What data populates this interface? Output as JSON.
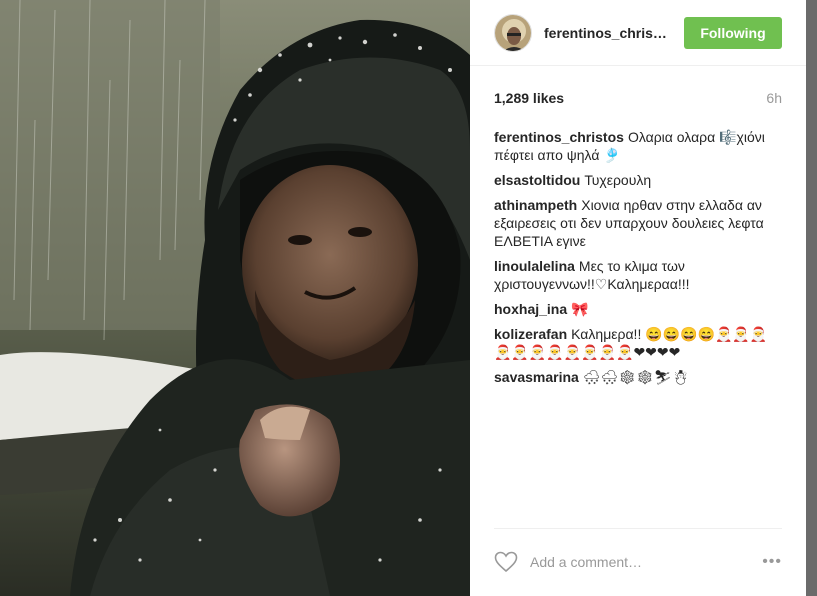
{
  "post": {
    "username": "ferentinos_chris…",
    "follow_label": "Following",
    "likes": "1,289 likes",
    "time": "6h"
  },
  "comments": [
    {
      "user": "ferentinos_christos",
      "text": "Ολαρια ολαρα 🎼χιόνι πέφτει απο ψηλά 🎐"
    },
    {
      "user": "elsastoltidou",
      "text": "Τυχερουλη"
    },
    {
      "user": "athinampeth",
      "text": "Χιονια ηρθαν στην ελλαδα αν εξαιρεσεις οτι δεν υπαρχουν δουλειες λεφτα ΕΛΒΕΤΙΑ εγινε"
    },
    {
      "user": "linoulalelina",
      "text": "Μες το κλιμα των χριστουγεννων!!♡Καλημεραα!!!"
    },
    {
      "user": "hoxhaj_ina",
      "text": "🎀"
    },
    {
      "user": "kolizerafan",
      "text": "Καλημερα!! 😄😄😄😄🎅🎅🎅🎅🎅🎅🎅🎅🎅🎅🎅❤❤❤❤"
    },
    {
      "user": "savasmarina",
      "text": "🌨🌨❄❄⛷☃"
    }
  ],
  "footer": {
    "comment_placeholder": "Add a comment…",
    "more_label": "•••"
  },
  "colors": {
    "follow_button": "#70c050",
    "secondary_text": "#999999"
  }
}
